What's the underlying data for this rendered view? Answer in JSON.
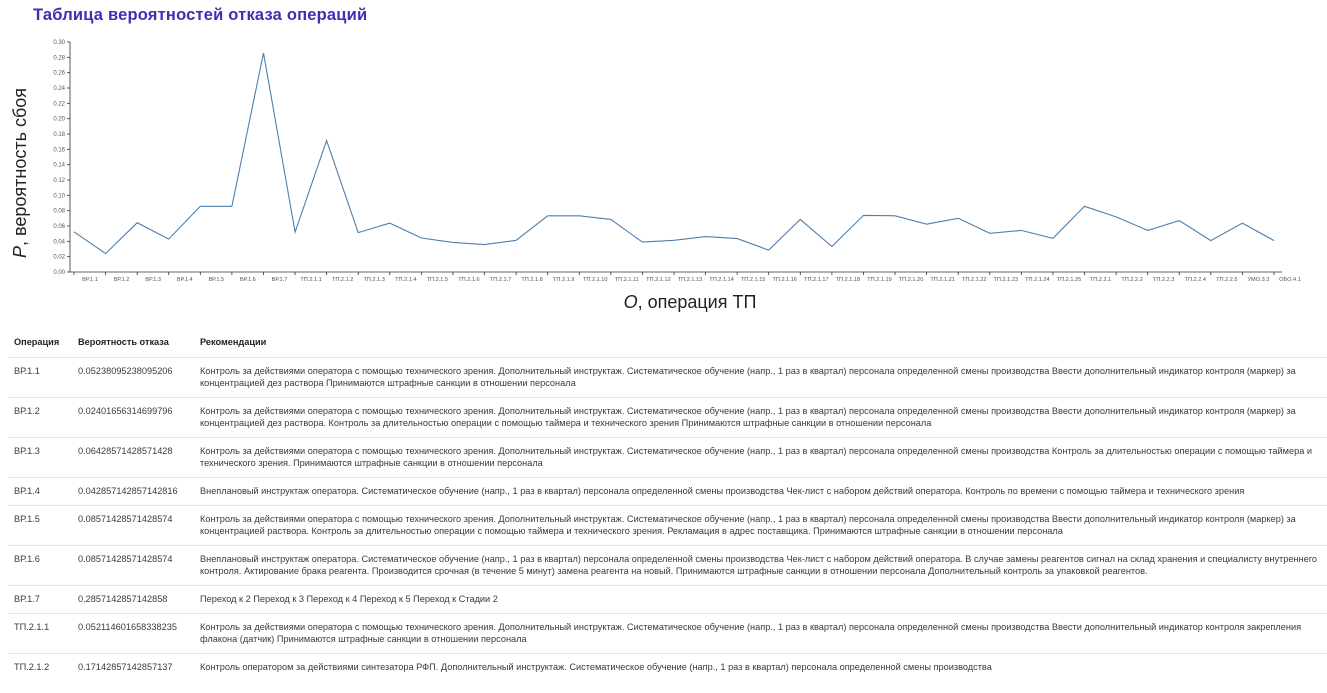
{
  "page": {
    "title": "Таблица вероятностей отказа операций"
  },
  "chart_data": {
    "type": "line",
    "title": "Таблица вероятностей отказа операций",
    "ylabel_italic": "P",
    "ylabel_rest": ", вероятность сбоя",
    "xlabel_italic": "O",
    "xlabel_rest": ", операция ТП",
    "ylim": [
      0,
      0.3
    ],
    "yticks": [
      "0.00",
      "0.02",
      "0.04",
      "0.06",
      "0.08",
      "0.10",
      "0.12",
      "0.14",
      "0.16",
      "0.18",
      "0.20",
      "0.22",
      "0.24",
      "0.26",
      "0.28",
      "0.30"
    ],
    "grid": false,
    "line_color": "#4e7fae",
    "categories": [
      "ВР.1.1",
      "ВР.1.2",
      "ВР.1.3",
      "ВР.1.4",
      "ВР.1.5",
      "ВР.1.6",
      "ВР.1.7",
      "ТП.2.1.1",
      "ТП.2.1.2",
      "ТП.2.1.3",
      "ТП.2.1.4",
      "ТП.2.1.5",
      "ТП.2.1.6",
      "ТП.2.1.7",
      "ТП.2.1.8",
      "ТП.2.1.9",
      "ТП.2.1.10",
      "ТП.2.1.11",
      "ТП.2.1.12",
      "ТП.2.1.13",
      "ТП.2.1.14",
      "ТП.2.1.15",
      "ТП.2.1.16",
      "ТП.2.1.17",
      "ТП.2.1.18",
      "ТП.2.1.19",
      "ТП.2.1.20",
      "ТП.2.1.21",
      "ТП.2.1.22",
      "ТП.2.1.23",
      "ТП.2.1.24",
      "ТП.2.1.25",
      "ТП.2.2.1",
      "ТП.2.2.2",
      "ТП.2.2.3",
      "ТП.2.2.4",
      "ТП.2.2.5",
      "УМО.3.3",
      "ОБО.4.1"
    ],
    "values": [
      0.0524,
      0.024,
      0.0643,
      0.0429,
      0.0857,
      0.0857,
      0.2857,
      0.0521,
      0.1714,
      0.0514,
      0.0638,
      0.0443,
      0.0386,
      0.0357,
      0.0414,
      0.0733,
      0.0733,
      0.0686,
      0.039,
      0.0414,
      0.0462,
      0.0436,
      0.0286,
      0.0686,
      0.0333,
      0.0738,
      0.0733,
      0.0624,
      0.07,
      0.0505,
      0.0543,
      0.0438,
      0.0857,
      0.0719,
      0.0543,
      0.0671,
      0.041,
      0.0638,
      0.041
    ]
  },
  "table": {
    "headers": [
      "Операция",
      "Вероятность отказа",
      "Рекомендации"
    ],
    "rows": [
      {
        "op": "ВР.1.1",
        "prob": "0.05238095238095206",
        "rec": "Контроль за действиями оператора с помощью технического зрения. Дополнительный инструктаж. Систематическое обучение (напр., 1 раз в квартал) персонала определенной смены производства Ввести дополнительный индикатор контроля (маркер) за концентрацией дез раствора Принимаются штрафные санкции в отношении персонала"
      },
      {
        "op": "ВР.1.2",
        "prob": "0.02401656314699796",
        "rec": "Контроль за действиями оператора с помощью технического зрения. Дополнительный инструктаж. Систематическое обучение (напр., 1 раз в квартал) персонала определенной смены производства Ввести дополнительный индикатор контроля (маркер) за концентрацией дез раствора. Контроль за длительностью операции с помощью таймера и технического зрения Принимаются штрафные санкции в отношении персонала"
      },
      {
        "op": "ВР.1.3",
        "prob": "0.06428571428571428",
        "rec": "Контроль за действиями оператора с помощью технического зрения. Дополнительный инструктаж. Систематическое обучение (напр., 1 раз в квартал) персонала определенной смены производства Контроль за длительностью операции с помощью таймера и технического зрения. Принимаются штрафные санкции в отношении персонала"
      },
      {
        "op": "ВР.1.4",
        "prob": "0.042857142857142816",
        "rec": "Внеплановый инструктаж оператора. Систематическое обучение (напр., 1 раз в квартал) персонала определенной смены производства Чек-лист с набором действий оператора. Контроль по времени с помощью таймера и технического зрения"
      },
      {
        "op": "ВР.1.5",
        "prob": "0.08571428571428574",
        "rec": "Контроль за действиями оператора с помощью технического зрения. Дополнительный инструктаж. Систематическое обучение (напр., 1 раз в квартал) персонала определенной смены производства Ввести дополнительный индикатор контроля (маркер) за концентрацией раствора. Контроль за длительностью операции с помощью таймера и технического зрения. Рекламация в адрес поставщика. Принимаются штрафные санкции в отношении персонала"
      },
      {
        "op": "ВР.1.6",
        "prob": "0.08571428571428574",
        "rec": "Внеплановый инструктаж оператора. Систематическое обучение (напр., 1 раз в квартал) персонала определенной смены производства Чек-лист с набором действий оператора. В случае замены реагентов сигнал на склад хранения и специалисту внутреннего контроля. Актирование брака реагента. Производится срочная (в течение 5 минут) замена реагента на новый. Принимаются штрафные санкции в отношении персонала Дополнительный контроль за упаковкой реагентов."
      },
      {
        "op": "ВР.1.7",
        "prob": "0.2857142857142858",
        "rec": "Переход к 2 Переход к 3 Переход к 4 Переход к 5 Переход к Стадии 2"
      },
      {
        "op": "ТП.2.1.1",
        "prob": "0.052114601658338235",
        "rec": "Контроль за действиями оператора с помощью технического зрения. Дополнительный инструктаж. Систематическое обучение (напр., 1 раз в квартал) персонала определенной смены производства Ввести дополнительный индикатор контроля закрепления флакона (датчик) Принимаются штрафные санкции в отношении персонала"
      },
      {
        "op": "ТП.2.1.2",
        "prob": "0.17142857142857137",
        "rec": "Контроль оператором за действиями синтезатора РФП. Дополнительный инструктаж. Систематическое обучение (напр., 1 раз в квартал) персонала определенной смены производства"
      }
    ]
  }
}
